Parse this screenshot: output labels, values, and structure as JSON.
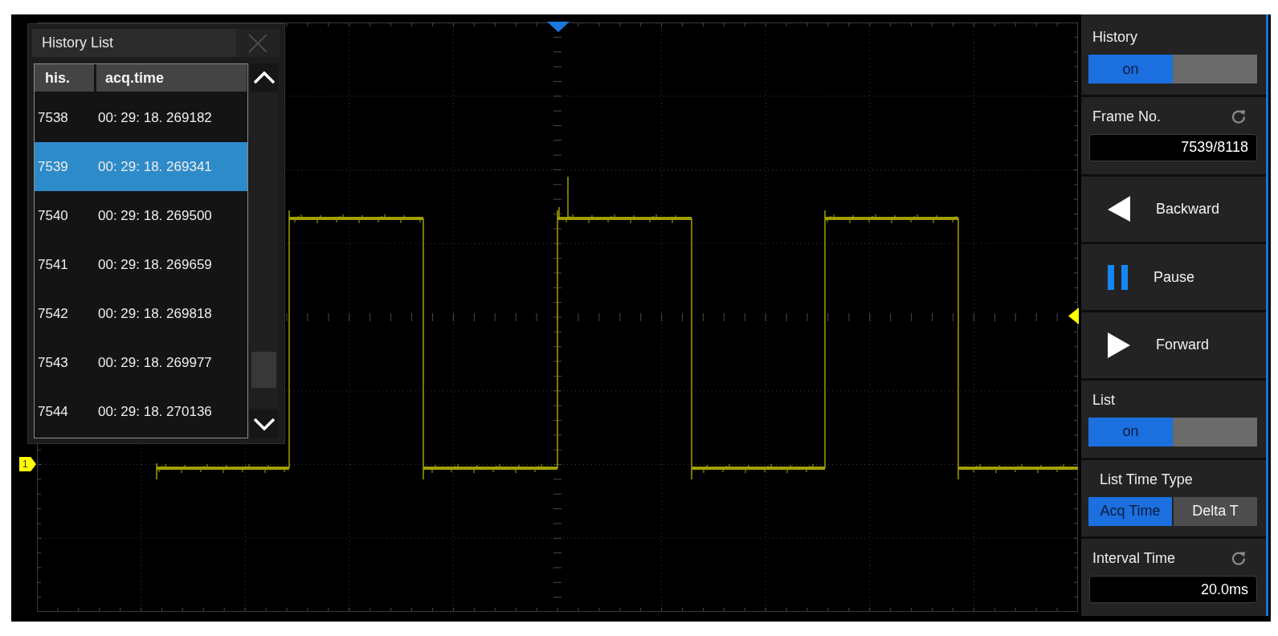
{
  "scope": {
    "channel_marker": "1"
  },
  "history_list": {
    "title": "History List",
    "columns": [
      "his.",
      "acq.time"
    ],
    "rows": [
      {
        "his": "7538",
        "acq_time": "00: 29: 18. 269182",
        "selected": false
      },
      {
        "his": "7539",
        "acq_time": "00: 29: 18. 269341",
        "selected": true
      },
      {
        "his": "7540",
        "acq_time": "00: 29: 18. 269500",
        "selected": false
      },
      {
        "his": "7541",
        "acq_time": "00: 29: 18. 269659",
        "selected": false
      },
      {
        "his": "7542",
        "acq_time": "00: 29: 18. 269818",
        "selected": false
      },
      {
        "his": "7543",
        "acq_time": "00: 29: 18. 269977",
        "selected": false
      },
      {
        "his": "7544",
        "acq_time": "00: 29: 18. 270136",
        "selected": false
      }
    ]
  },
  "menu": {
    "items": [
      {
        "kind": "toggle",
        "label": "History",
        "value": "on",
        "on": true
      },
      {
        "kind": "field",
        "label": "Frame No.",
        "value": "7539/8118"
      },
      {
        "kind": "back",
        "label": "Backward"
      },
      {
        "kind": "pause",
        "label": "Pause"
      },
      {
        "kind": "forward",
        "label": "Forward"
      },
      {
        "kind": "toggle",
        "label": "List",
        "value": "on",
        "on": true
      },
      {
        "kind": "segmented",
        "label": "List Time Type",
        "options": [
          {
            "label": "Acq Time",
            "selected": true
          },
          {
            "label": "Delta T",
            "selected": false
          }
        ]
      },
      {
        "kind": "field",
        "label": "Interval Time",
        "value": "20.0ms"
      }
    ]
  }
}
